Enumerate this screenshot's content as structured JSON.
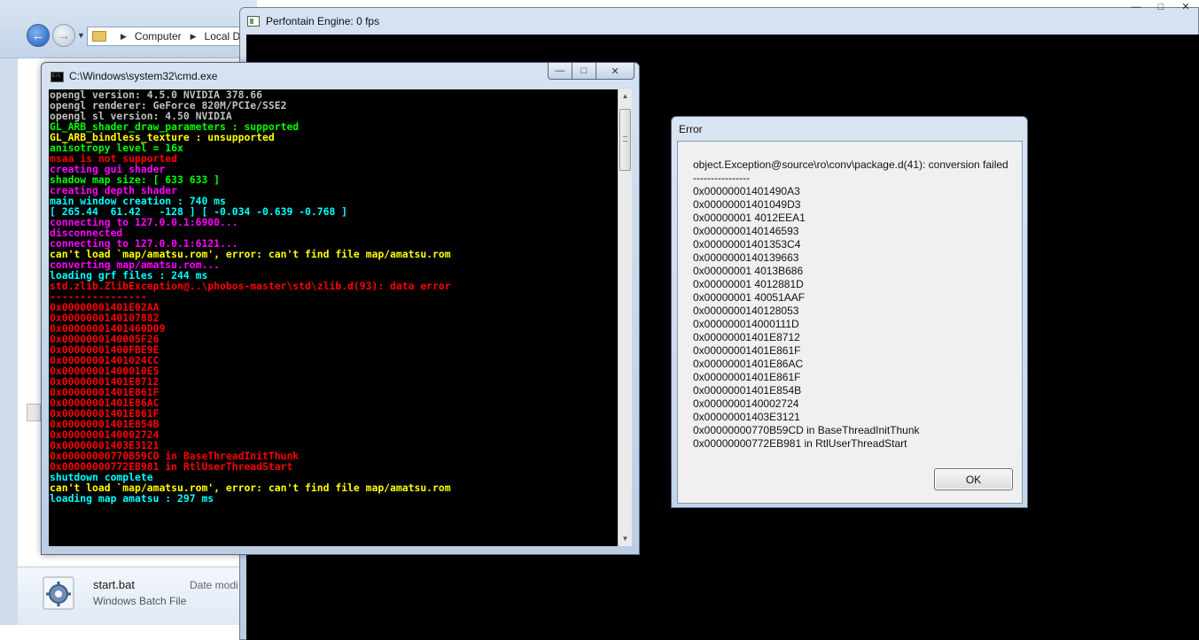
{
  "explorer": {
    "breadcrumb": [
      "Computer",
      "Local Disk"
    ],
    "file": {
      "name": "start.bat",
      "type": "Windows Batch File",
      "date_label": "Date modi"
    }
  },
  "engine": {
    "title": "Perfontain Engine: 0 fps"
  },
  "cmd": {
    "title": "C:\\Windows\\system32\\cmd.exe",
    "lines": [
      {
        "text": "opengl version: 4.5.0 NVIDIA 378.66",
        "color": "#c0c0c0"
      },
      {
        "text": "opengl renderer: GeForce 820M/PCIe/SSE2",
        "color": "#c0c0c0"
      },
      {
        "text": "opengl sl version: 4.50 NVIDIA",
        "color": "#c0c0c0"
      },
      {
        "text": "GL_ARB_shader_draw_parameters : supported",
        "color": "#00ff00"
      },
      {
        "text": "GL_ARB_bindless_texture : unsupported",
        "color": "#ffff00"
      },
      {
        "text": "anisotropy level = 16x",
        "color": "#00ff00"
      },
      {
        "text": "msaa is not supported",
        "color": "#ff0000"
      },
      {
        "text": "creating gui shader",
        "color": "#ff00ff"
      },
      {
        "text": "shadow map size: [ 633 633 ]",
        "color": "#00ff00"
      },
      {
        "text": "creating depth shader",
        "color": "#ff00ff"
      },
      {
        "text": "main window creation : 740 ms",
        "color": "#00ffff"
      },
      {
        "text": "[ 265.44  61.42   -128 ] [ -0.034 -0.639 -0.768 ]",
        "color": "#00ffff"
      },
      {
        "text": "connecting to 127.0.0.1:6900...",
        "color": "#ff00ff"
      },
      {
        "text": "disconnected",
        "color": "#ff00ff"
      },
      {
        "text": "connecting to 127.0.0.1:6121...",
        "color": "#ff00ff"
      },
      {
        "text": "can't load `map/amatsu.rom', error: can't find file map/amatsu.rom",
        "color": "#ffff00"
      },
      {
        "text": "converting map/amatsu.rom...",
        "color": "#ff00ff"
      },
      {
        "text": "loading grf files : 244 ms",
        "color": "#00ffff"
      },
      {
        "text": "std.zlib.ZlibException@..\\phobos-master\\std\\zlib.d(93): data error",
        "color": "#ff0000"
      },
      {
        "text": "----------------",
        "color": "#ff0000"
      },
      {
        "text": "0x00000001401E02AA",
        "color": "#ff0000"
      },
      {
        "text": "0x0000000140107882",
        "color": "#ff0000"
      },
      {
        "text": "0x00000001401460D09",
        "color": "#ff0000"
      },
      {
        "text": "0x0000000140005F26",
        "color": "#ff0000"
      },
      {
        "text": "0x00000001400FBE9E",
        "color": "#ff0000"
      },
      {
        "text": "0x00000001401024CC",
        "color": "#ff0000"
      },
      {
        "text": "0x00000001400010E5",
        "color": "#ff0000"
      },
      {
        "text": "0x00000001401E8712",
        "color": "#ff0000"
      },
      {
        "text": "0x00000001401E861F",
        "color": "#ff0000"
      },
      {
        "text": "0x00000001401E86AC",
        "color": "#ff0000"
      },
      {
        "text": "0x00000001401E861F",
        "color": "#ff0000"
      },
      {
        "text": "0x00000001401E854B",
        "color": "#ff0000"
      },
      {
        "text": "0x0000000140002724",
        "color": "#ff0000"
      },
      {
        "text": "0x00000001403E3121",
        "color": "#ff0000"
      },
      {
        "text": "0x00000000770B59CD in BaseThreadInitThunk",
        "color": "#ff0000"
      },
      {
        "text": "0x00000000772EB981 in RtlUserThreadStart",
        "color": "#ff0000"
      },
      {
        "text": "shutdown complete",
        "color": "#00ffff"
      },
      {
        "text": "can't load `map/amatsu.rom', error: can't find file map/amatsu.rom",
        "color": "#ffff00"
      },
      {
        "text": "loading map amatsu : 297 ms",
        "color": "#00ffff"
      }
    ]
  },
  "error_dialog": {
    "title": "Error",
    "message_lines": [
      "object.Exception@source\\ro\\conv\\package.d(41): conversion failed",
      "----------------",
      "0x00000001401490A3",
      "0x00000001401049D3",
      "0x00000001 4012EEA1",
      "0x0000000140146593",
      "0x00000001401353C4",
      "0x0000000140139663",
      "0x00000001 4013B686",
      "0x00000001 4012881D",
      "0x00000001 40051AAF",
      "0x0000000140128053",
      "0x000000014000111D",
      "0x00000001401E8712",
      "0x00000001401E861F",
      "0x00000001401E86AC",
      "0x00000001401E861F",
      "0x00000001401E854B",
      "0x0000000140002724",
      "0x00000001403E3121",
      "0x00000000770B59CD in BaseThreadInitThunk",
      "0x00000000772EB981 in RtlUserThreadStart"
    ],
    "ok_label": "OK"
  }
}
